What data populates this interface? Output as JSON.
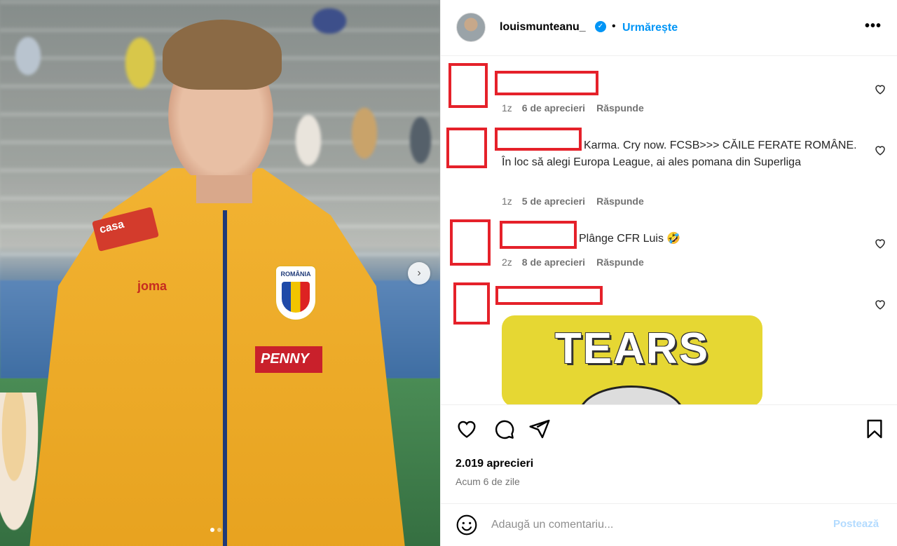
{
  "post": {
    "username": "louismunteanu_",
    "verified_mark": "✓",
    "separator": "•",
    "follow_label": "Urmărește",
    "more_label": "•••",
    "likes_count": "2.019 aprecieri",
    "time_ago": "Acum 6 de zile"
  },
  "photo": {
    "sponsor_1": "casa",
    "sponsor_2": "PENNY",
    "crest_text": "ROMÂNIA",
    "brand": "joma",
    "next_arrow": "›"
  },
  "comments": [
    {
      "text": "",
      "time": "1z",
      "likes": "6 de aprecieri",
      "reply": "Răspunde"
    },
    {
      "text": "Karma. Cry now. FCSB>>> CĂILE FERATE ROMÂNE. În loc să alegi Europa League, ai ales pomana din Superliga",
      "time": "1z",
      "likes": "5 de aprecieri",
      "reply": "Răspunde"
    },
    {
      "text": "Plânge CFR Luis 🤣",
      "time": "2z",
      "likes": "8 de aprecieri",
      "reply": "Răspunde"
    },
    {
      "text": "",
      "gif_text": "TEARS"
    }
  ],
  "add_comment": {
    "placeholder": "Adaugă un comentariu...",
    "post_label": "Postează"
  },
  "icons": [
    "heart-icon",
    "comment-icon",
    "share-icon",
    "bookmark-icon",
    "emoji-icon",
    "more-icon",
    "verified-icon"
  ],
  "colors": {
    "link": "#0095f6",
    "redaction": "#e5212a",
    "muted": "#737373",
    "post_disabled": "#b3dbff"
  }
}
